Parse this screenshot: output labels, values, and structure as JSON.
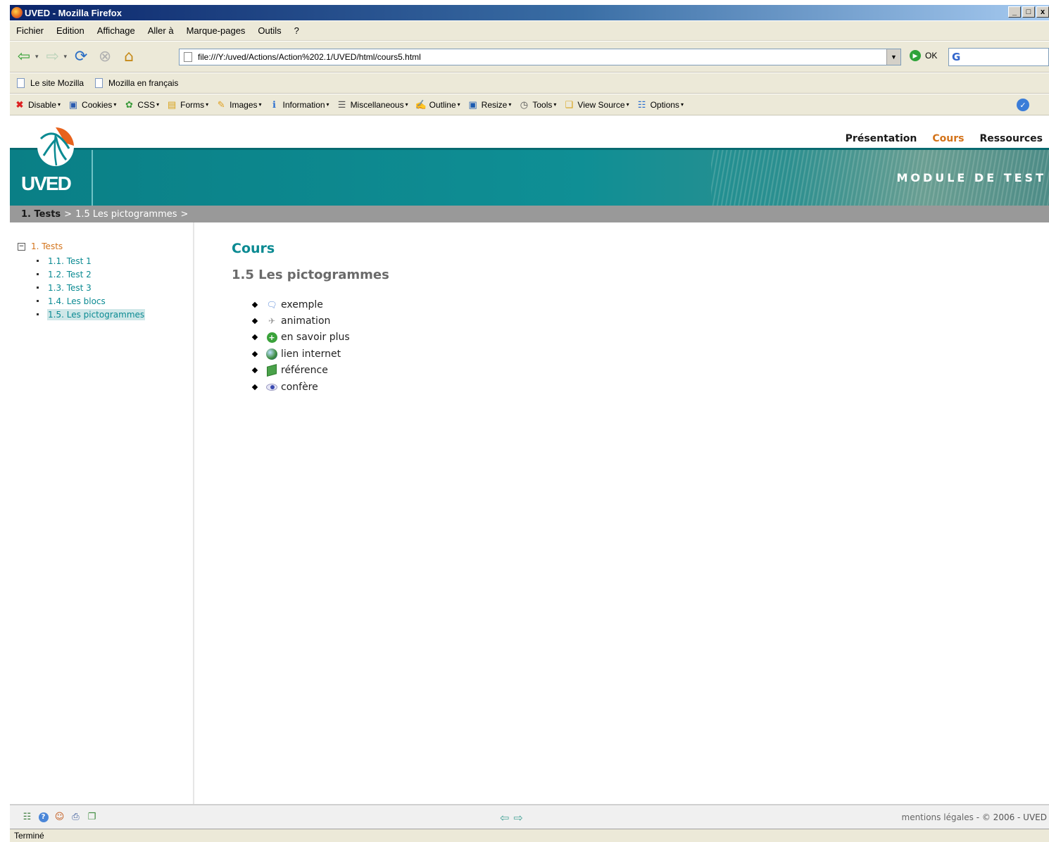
{
  "window": {
    "title": "UVED - Mozilla Firefox",
    "buttons": [
      "_",
      "□",
      "x"
    ]
  },
  "menubar": {
    "items": [
      "Fichier",
      "Edition",
      "Affichage",
      "Aller à",
      "Marque-pages",
      "Outils",
      "?"
    ]
  },
  "navbar": {
    "url": "file:///Y:/uved/Actions/Action%202.1/UVED/html/cours5.html",
    "go_label": "OK",
    "search_placeholder": "G"
  },
  "bookmarks": {
    "items": [
      "Le site Mozilla",
      "Mozilla en français"
    ]
  },
  "devbar": {
    "items": [
      {
        "label": "Disable",
        "icon": "red-x-icon"
      },
      {
        "label": "Cookies",
        "icon": "cookie-icon"
      },
      {
        "label": "CSS",
        "icon": "css-icon"
      },
      {
        "label": "Forms",
        "icon": "lock-icon"
      },
      {
        "label": "Images",
        "icon": "images-icon"
      },
      {
        "label": "Information",
        "icon": "info-icon"
      },
      {
        "label": "Miscellaneous",
        "icon": "list-icon"
      },
      {
        "label": "Outline",
        "icon": "pen-icon"
      },
      {
        "label": "Resize",
        "icon": "resize-icon"
      },
      {
        "label": "Tools",
        "icon": "clock-icon"
      },
      {
        "label": "View Source",
        "icon": "source-icon"
      },
      {
        "label": "Options",
        "icon": "options-icon"
      }
    ]
  },
  "site": {
    "logo_text": "UVED",
    "topnav": [
      {
        "label": "Présentation",
        "active": false
      },
      {
        "label": "Cours",
        "active": true
      },
      {
        "label": "Ressources",
        "active": false
      }
    ],
    "module_title": "MODULE DE TEST",
    "colors": {
      "teal": "#0a8a92",
      "orange": "#d3731a",
      "breadcrumb_bg": "#999999"
    }
  },
  "breadcrumb": {
    "root": "1. Tests",
    "separator": ">",
    "current": "1.5 Les pictogrammes",
    "trailing": ">"
  },
  "sidebar": {
    "toggle": "−",
    "root_label": "1. Tests",
    "items": [
      {
        "label": "1.1. Test 1",
        "current": false
      },
      {
        "label": "1.2. Test 2",
        "current": false
      },
      {
        "label": "1.3. Test 3",
        "current": false
      },
      {
        "label": "1.4. Les blocs",
        "current": false
      },
      {
        "label": "1.5. Les pictogrammes",
        "current": true
      }
    ]
  },
  "content": {
    "title": "Cours",
    "subtitle": "1.5 Les pictogrammes",
    "pictos": [
      {
        "label": "exemple",
        "icon": "speech-bubble-icon"
      },
      {
        "label": "animation",
        "icon": "film-icon"
      },
      {
        "label": "en savoir plus",
        "icon": "plus-circle-icon"
      },
      {
        "label": "lien internet",
        "icon": "globe-icon"
      },
      {
        "label": "référence",
        "icon": "book-icon"
      },
      {
        "label": "confère",
        "icon": "eye-icon"
      }
    ]
  },
  "footer": {
    "icons": [
      "sitemap-icon",
      "help-icon",
      "user-icon",
      "print-icon",
      "document-icon"
    ],
    "prev_arrow": "⇦",
    "next_arrow": "⇨",
    "legal": "mentions légales",
    "copyright": "- © 2006 - UVED"
  },
  "status": {
    "text": "Terminé"
  }
}
